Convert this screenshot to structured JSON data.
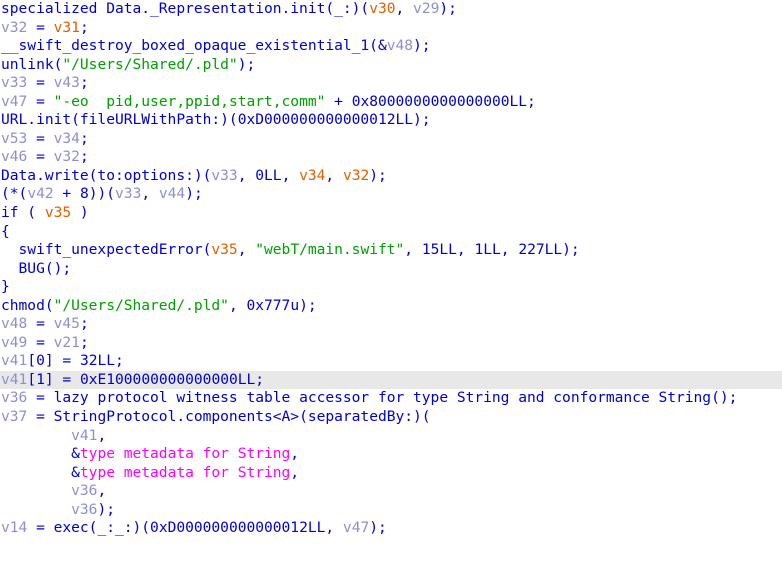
{
  "view": {
    "name": "hex-rays-pseudocode",
    "background_color": "#ffffff",
    "highlight_color": "#e8e8e8",
    "colors": {
      "code": "#0000d0",
      "string": "#00a000",
      "local_variable": "#8f8fd0",
      "argument_variable": "#e06000",
      "global_symbol": "#ff00ff"
    }
  },
  "lines": [
    {
      "id": 0,
      "highlighted": false,
      "text": "specialized Data._Representation.init(_:)(v30, v29);",
      "tokens": [
        {
          "t": "specialized Data._Representation.init(_:)(",
          "c": "code"
        },
        {
          "t": "v30",
          "c": "arg"
        },
        {
          "t": ", ",
          "c": "code"
        },
        {
          "t": "v29",
          "c": "lvar"
        },
        {
          "t": ");",
          "c": "code"
        }
      ]
    },
    {
      "id": 1,
      "highlighted": false,
      "text": "v32 = v31;",
      "tokens": [
        {
          "t": "v32",
          "c": "lvar"
        },
        {
          "t": " = ",
          "c": "code"
        },
        {
          "t": "v31",
          "c": "arg"
        },
        {
          "t": ";",
          "c": "code"
        }
      ]
    },
    {
      "id": 2,
      "highlighted": false,
      "text": "__swift_destroy_boxed_opaque_existential_1(&v48);",
      "tokens": [
        {
          "t": "__swift_destroy_boxed_opaque_existential_1(&",
          "c": "code"
        },
        {
          "t": "v48",
          "c": "lvar"
        },
        {
          "t": ");",
          "c": "code"
        }
      ]
    },
    {
      "id": 3,
      "highlighted": false,
      "text": "unlink(\"/Users/Shared/.pld\");",
      "tokens": [
        {
          "t": "unlink(",
          "c": "code"
        },
        {
          "t": "\"/Users/Shared/.pld\"",
          "c": "str"
        },
        {
          "t": ");",
          "c": "code"
        }
      ]
    },
    {
      "id": 4,
      "highlighted": false,
      "text": "v33 = v43;",
      "tokens": [
        {
          "t": "v33",
          "c": "lvar"
        },
        {
          "t": " = ",
          "c": "code"
        },
        {
          "t": "v43",
          "c": "lvar"
        },
        {
          "t": ";",
          "c": "code"
        }
      ]
    },
    {
      "id": 5,
      "highlighted": false,
      "text": "v47 = \"-eo  pid,user,ppid,start,comm\" + 0x8000000000000000LL;",
      "tokens": [
        {
          "t": "v47",
          "c": "lvar"
        },
        {
          "t": " = ",
          "c": "code"
        },
        {
          "t": "\"-eo  pid,user,ppid,start,comm\"",
          "c": "str"
        },
        {
          "t": " + ",
          "c": "code"
        },
        {
          "t": "0x8000000000000000LL",
          "c": "num"
        },
        {
          "t": ";",
          "c": "code"
        }
      ]
    },
    {
      "id": 6,
      "highlighted": false,
      "text": "URL.init(fileURLWithPath:)(0xD000000000000012LL);",
      "tokens": [
        {
          "t": "URL.init(fileURLWithPath:)(",
          "c": "code"
        },
        {
          "t": "0xD000000000000012LL",
          "c": "num"
        },
        {
          "t": ");",
          "c": "code"
        }
      ]
    },
    {
      "id": 7,
      "highlighted": false,
      "text": "v53 = v34;",
      "tokens": [
        {
          "t": "v53",
          "c": "lvar"
        },
        {
          "t": " = ",
          "c": "code"
        },
        {
          "t": "v34",
          "c": "lvar"
        },
        {
          "t": ";",
          "c": "code"
        }
      ]
    },
    {
      "id": 8,
      "highlighted": false,
      "text": "v46 = v32;",
      "tokens": [
        {
          "t": "v46",
          "c": "lvar"
        },
        {
          "t": " = ",
          "c": "code"
        },
        {
          "t": "v32",
          "c": "lvar"
        },
        {
          "t": ";",
          "c": "code"
        }
      ]
    },
    {
      "id": 9,
      "highlighted": false,
      "text": "Data.write(to:options:)(v33, 0LL, v34, v32);",
      "tokens": [
        {
          "t": "Data.write(to:options:)(",
          "c": "code"
        },
        {
          "t": "v33",
          "c": "lvar"
        },
        {
          "t": ", ",
          "c": "code"
        },
        {
          "t": "0LL",
          "c": "num"
        },
        {
          "t": ", ",
          "c": "code"
        },
        {
          "t": "v34",
          "c": "arg"
        },
        {
          "t": ", ",
          "c": "code"
        },
        {
          "t": "v32",
          "c": "arg"
        },
        {
          "t": ");",
          "c": "code"
        }
      ]
    },
    {
      "id": 10,
      "highlighted": false,
      "text": "(*(v42 + 8))(v33, v44);",
      "tokens": [
        {
          "t": "(*(",
          "c": "code"
        },
        {
          "t": "v42",
          "c": "lvar"
        },
        {
          "t": " + ",
          "c": "code"
        },
        {
          "t": "8",
          "c": "num"
        },
        {
          "t": "))(",
          "c": "code"
        },
        {
          "t": "v33",
          "c": "lvar"
        },
        {
          "t": ", ",
          "c": "code"
        },
        {
          "t": "v44",
          "c": "lvar"
        },
        {
          "t": ");",
          "c": "code"
        }
      ]
    },
    {
      "id": 11,
      "highlighted": false,
      "text": "if ( v35 )",
      "tokens": [
        {
          "t": "if ( ",
          "c": "kw"
        },
        {
          "t": "v35",
          "c": "arg"
        },
        {
          "t": " )",
          "c": "kw"
        }
      ]
    },
    {
      "id": 12,
      "highlighted": false,
      "text": "{",
      "tokens": [
        {
          "t": "{",
          "c": "code"
        }
      ]
    },
    {
      "id": 13,
      "highlighted": false,
      "text": "  swift_unexpectedError(v35, \"webT/main.swift\", 15LL, 1LL, 227LL);",
      "tokens": [
        {
          "t": "  swift_unexpectedError(",
          "c": "code"
        },
        {
          "t": "v35",
          "c": "arg"
        },
        {
          "t": ", ",
          "c": "code"
        },
        {
          "t": "\"webT/main.swift\"",
          "c": "str"
        },
        {
          "t": ", ",
          "c": "code"
        },
        {
          "t": "15LL",
          "c": "num"
        },
        {
          "t": ", ",
          "c": "code"
        },
        {
          "t": "1LL",
          "c": "num"
        },
        {
          "t": ", ",
          "c": "code"
        },
        {
          "t": "227LL",
          "c": "num"
        },
        {
          "t": ");",
          "c": "code"
        }
      ]
    },
    {
      "id": 14,
      "highlighted": false,
      "text": "  BUG();",
      "tokens": [
        {
          "t": "  BUG();",
          "c": "code"
        }
      ]
    },
    {
      "id": 15,
      "highlighted": false,
      "text": "}",
      "tokens": [
        {
          "t": "}",
          "c": "code"
        }
      ]
    },
    {
      "id": 16,
      "highlighted": false,
      "text": "chmod(\"/Users/Shared/.pld\", 0x777u);",
      "tokens": [
        {
          "t": "chmod(",
          "c": "code"
        },
        {
          "t": "\"/Users/Shared/.pld\"",
          "c": "str"
        },
        {
          "t": ", ",
          "c": "code"
        },
        {
          "t": "0x777u",
          "c": "num"
        },
        {
          "t": ");",
          "c": "code"
        }
      ]
    },
    {
      "id": 17,
      "highlighted": false,
      "text": "v48 = v45;",
      "tokens": [
        {
          "t": "v48",
          "c": "lvar"
        },
        {
          "t": " = ",
          "c": "code"
        },
        {
          "t": "v45",
          "c": "lvar"
        },
        {
          "t": ";",
          "c": "code"
        }
      ]
    },
    {
      "id": 18,
      "highlighted": false,
      "text": "v49 = v21;",
      "tokens": [
        {
          "t": "v49",
          "c": "lvar"
        },
        {
          "t": " = ",
          "c": "code"
        },
        {
          "t": "v21",
          "c": "lvar"
        },
        {
          "t": ";",
          "c": "code"
        }
      ]
    },
    {
      "id": 19,
      "highlighted": false,
      "text": "v41[0] = 32LL;",
      "tokens": [
        {
          "t": "v41",
          "c": "lvar"
        },
        {
          "t": "[",
          "c": "code"
        },
        {
          "t": "0",
          "c": "num"
        },
        {
          "t": "] = ",
          "c": "code"
        },
        {
          "t": "32LL",
          "c": "num"
        },
        {
          "t": ";",
          "c": "code"
        }
      ]
    },
    {
      "id": 20,
      "highlighted": true,
      "text": "v41[1] = 0xE100000000000000LL;",
      "tokens": [
        {
          "t": "v41",
          "c": "lvar"
        },
        {
          "t": "[",
          "c": "code"
        },
        {
          "t": "1",
          "c": "num"
        },
        {
          "t": "] = ",
          "c": "code"
        },
        {
          "t": "0xE100000000000000LL",
          "c": "num"
        },
        {
          "t": ";",
          "c": "code"
        }
      ]
    },
    {
      "id": 21,
      "highlighted": false,
      "text": "v36 = lazy protocol witness table accessor for type String and conformance String();",
      "tokens": [
        {
          "t": "v36",
          "c": "lvar"
        },
        {
          "t": " = lazy protocol witness table accessor for type String and conformance String();",
          "c": "code"
        }
      ]
    },
    {
      "id": 22,
      "highlighted": false,
      "text": "v37 = StringProtocol.components<A>(separatedBy:)(",
      "tokens": [
        {
          "t": "v37",
          "c": "lvar"
        },
        {
          "t": " = StringProtocol.components<A>(separatedBy:)(",
          "c": "code"
        }
      ]
    },
    {
      "id": 23,
      "highlighted": false,
      "text": "        v41,",
      "tokens": [
        {
          "t": "        ",
          "c": "code"
        },
        {
          "t": "v41",
          "c": "lvar"
        },
        {
          "t": ",",
          "c": "code"
        }
      ]
    },
    {
      "id": 24,
      "highlighted": false,
      "text": "        &type metadata for String,",
      "tokens": [
        {
          "t": "        &",
          "c": "code"
        },
        {
          "t": "type metadata for String",
          "c": "globl"
        },
        {
          "t": ",",
          "c": "code"
        }
      ]
    },
    {
      "id": 25,
      "highlighted": false,
      "text": "        &type metadata for String,",
      "tokens": [
        {
          "t": "        &",
          "c": "code"
        },
        {
          "t": "type metadata for String",
          "c": "globl"
        },
        {
          "t": ",",
          "c": "code"
        }
      ]
    },
    {
      "id": 26,
      "highlighted": false,
      "text": "        v36,",
      "tokens": [
        {
          "t": "        ",
          "c": "code"
        },
        {
          "t": "v36",
          "c": "lvar"
        },
        {
          "t": ",",
          "c": "code"
        }
      ]
    },
    {
      "id": 27,
      "highlighted": false,
      "text": "        v36);",
      "tokens": [
        {
          "t": "        ",
          "c": "code"
        },
        {
          "t": "v36",
          "c": "lvar"
        },
        {
          "t": ");",
          "c": "code"
        }
      ]
    },
    {
      "id": 28,
      "highlighted": false,
      "text": "v14 = exec(_:_:)(0xD000000000000012LL, v47);",
      "tokens": [
        {
          "t": "v14",
          "c": "lvar"
        },
        {
          "t": " = exec(_:_:)(",
          "c": "code"
        },
        {
          "t": "0xD000000000000012LL",
          "c": "num"
        },
        {
          "t": ", ",
          "c": "code"
        },
        {
          "t": "v47",
          "c": "lvar"
        },
        {
          "t": ");",
          "c": "code"
        }
      ]
    }
  ]
}
